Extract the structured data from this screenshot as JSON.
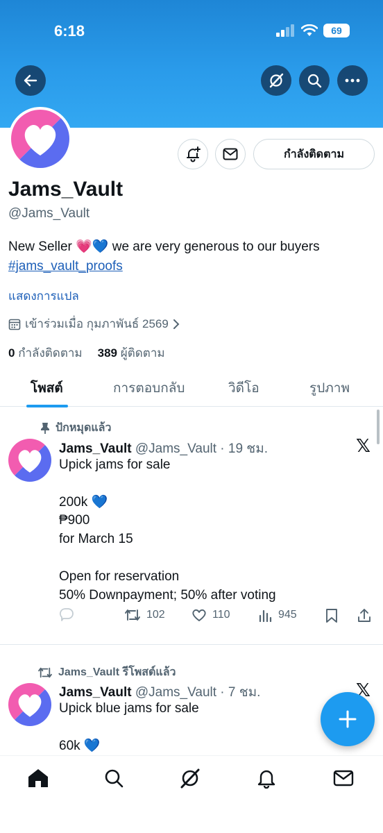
{
  "status_bar": {
    "time": "6:18",
    "battery": "69"
  },
  "profile": {
    "display_name": "Jams_Vault",
    "handle": "@Jams_Vault",
    "bio_text": "New Seller 💗💙 we are very generous to our buyers",
    "bio_hashtag": "#jams_vault_proofs",
    "translate_label": "แสดงการแปล",
    "joined_text": "เข้าร่วมเมื่อ กุมภาพันธ์ 2569",
    "following_count": "0",
    "following_label": "กำลังติดตาม",
    "followers_count": "389",
    "followers_label": "ผู้ติดตาม",
    "follow_button_label": "กำลังติดตาม"
  },
  "tabs": [
    "โพสต์",
    "การตอบกลับ",
    "วิดีโอ",
    "รูปภาพ"
  ],
  "posts": [
    {
      "context_label": "ปักหมุดแล้ว",
      "author_name": "Jams_Vault",
      "meta": "@Jams_Vault · 19 ชม.",
      "text": "Upick jams for sale\n\n200k 💙\n₱900\nfor March 15\n\nOpen for reservation\n50% Downpayment; 50% after voting",
      "reposts": "102",
      "likes": "110",
      "views": "945"
    },
    {
      "context_label": "Jams_Vault รีโพสต์แล้ว",
      "author_name": "Jams_Vault",
      "meta": "@Jams_Vault · 7 ชม.",
      "text": "Upick blue jams for sale\n\n60k 💙"
    }
  ],
  "colors": {
    "accent": "#1d9bf0",
    "banner": "#2a9bea",
    "link": "#1d5fb8"
  }
}
